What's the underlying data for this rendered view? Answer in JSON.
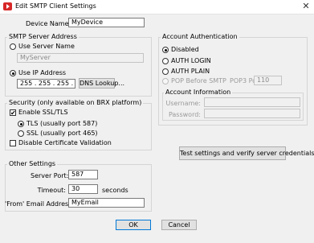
{
  "window": {
    "title": "Edit SMTP Client Settings",
    "close_glyph": "✕"
  },
  "device_name": {
    "label": "Device Name:",
    "value": "MyDevice"
  },
  "smtp_server_address": {
    "title": "SMTP Server Address",
    "use_server_name": {
      "label": "Use Server Name",
      "selected": false
    },
    "server_name_value": "MyServer",
    "use_ip_address": {
      "label": "Use IP Address",
      "selected": true
    },
    "ip_address_value": "255 . 255 . 255 . 255",
    "dns_lookup_label": "DNS Lookup..."
  },
  "security": {
    "title": "Security (only available on BRX platform)",
    "enable_ssl_tls": {
      "label": "Enable SSL/TLS",
      "checked": true,
      "check_glyph": "✔"
    },
    "tls": {
      "label": "TLS (usually port 587)",
      "selected": true
    },
    "ssl": {
      "label": "SSL (usually port 465)",
      "selected": false
    },
    "disable_cert_validation": {
      "label": "Disable Certificate Validation",
      "checked": false
    }
  },
  "other_settings": {
    "title": "Other Settings",
    "server_port": {
      "label": "Server Port:",
      "value": "587"
    },
    "timeout": {
      "label": "Timeout:",
      "value": "30",
      "units": "seconds"
    },
    "from_email": {
      "label": "'From' Email Address:",
      "value": "MyEmail"
    }
  },
  "account_authentication": {
    "title": "Account Authentication",
    "disabled": {
      "label": "Disabled",
      "selected": true
    },
    "auth_login": {
      "label": "AUTH LOGIN",
      "selected": false
    },
    "auth_plain": {
      "label": "AUTH PLAIN",
      "selected": false
    },
    "pop_before_smtp": {
      "label": "POP Before SMTP",
      "selected": false,
      "enabled": false
    },
    "pop3_port": {
      "label": "POP3 Port:",
      "value": "110"
    }
  },
  "account_information": {
    "title": "Account Information",
    "username_label": "Username:",
    "password_label": "Password:"
  },
  "test_button_label": "Test settings and verify server credentials",
  "ok_label": "OK",
  "cancel_label": "Cancel",
  "colors": {
    "accent": "#0078d7",
    "app_icon": "#d72828"
  }
}
